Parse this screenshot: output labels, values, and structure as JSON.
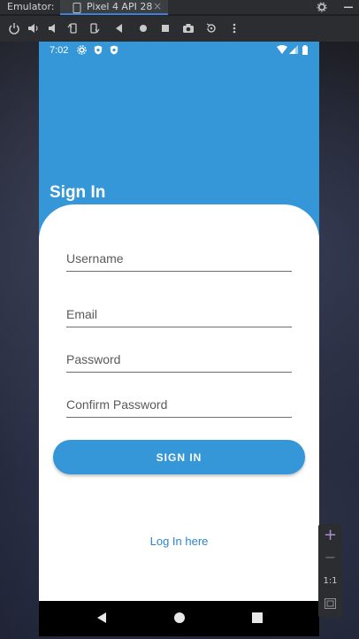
{
  "ide": {
    "panel_label": "Emulator:",
    "device_tab": "Pixel 4 API 28",
    "tab_close": "×"
  },
  "status_bar": {
    "time": "7:02"
  },
  "screen": {
    "title": "Sign In",
    "fields": {
      "username_placeholder": "Username",
      "email_placeholder": "Email",
      "password_placeholder": "Password",
      "confirm_password_placeholder": "Confirm Password"
    },
    "sign_in_button": "SIGN IN",
    "login_link": "Log In here"
  },
  "zoom": {
    "zoom_in": "+",
    "zoom_out": "−",
    "actual_size": "1:1"
  },
  "colors": {
    "accent": "#3597d8",
    "link": "#2b86c9"
  }
}
